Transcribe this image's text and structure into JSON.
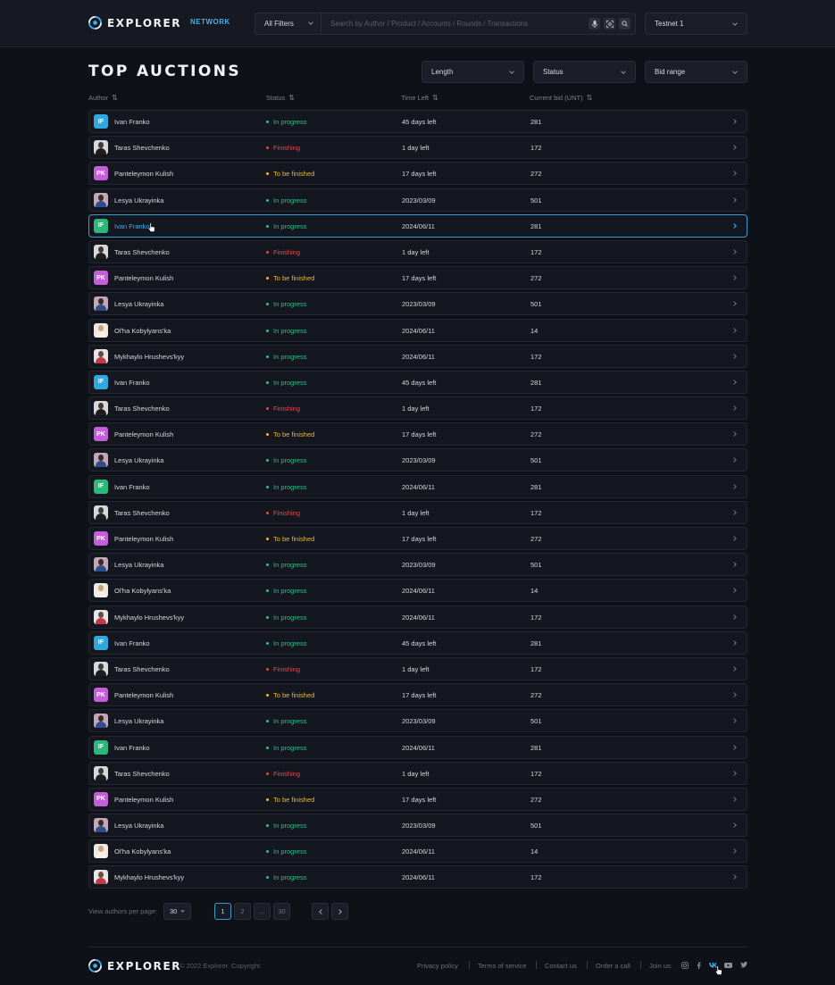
{
  "header": {
    "logo_text": "EXPLORER",
    "nav_network": "NETWORK",
    "filter_label": "All Filters",
    "search_placeholder": "Search by Author / Product / Accounts / Rounds / Transactions",
    "network_select": "Testnet 1"
  },
  "page": {
    "title": "TOP AUCTIONS",
    "filters": [
      "Length",
      "Status",
      "Bid range"
    ]
  },
  "table": {
    "columns": [
      "Author",
      "Status",
      "Time Left",
      "Current bid (UNT)"
    ],
    "rows": [
      {
        "avatar": "IF",
        "name": "Ivan Franko",
        "status": "In progress",
        "time": "45 days left",
        "bid": "281"
      },
      {
        "avatar": "TS",
        "name": "Taras Shevchenko",
        "status": "Finishing",
        "time": "1 day left",
        "bid": "172"
      },
      {
        "avatar": "PK",
        "name": "Panteleymon Kulish",
        "status": "To be finished",
        "time": "17 days left",
        "bid": "272"
      },
      {
        "avatar": "LU",
        "name": "Lesya Ukrayinka",
        "status": "In progress",
        "time": "2023/03/09",
        "bid": "501"
      },
      {
        "avatar": "IF",
        "name": "Ivan Franko",
        "status": "In progress",
        "time": "2024/06/11",
        "bid": "281"
      },
      {
        "avatar": "TS",
        "name": "Taras Shevchenko",
        "status": "Finishing",
        "time": "1 day left",
        "bid": "172"
      },
      {
        "avatar": "PK",
        "name": "Panteleymon Kulish",
        "status": "To be finished",
        "time": "17 days left",
        "bid": "272"
      },
      {
        "avatar": "LU",
        "name": "Lesya Ukrayinka",
        "status": "In progress",
        "time": "2023/03/09",
        "bid": "501"
      },
      {
        "avatar": "OK",
        "name": "Ol'ha Kobylyans'ka",
        "status": "In progress",
        "time": "2024/06/11",
        "bid": "14"
      },
      {
        "avatar": "MH",
        "name": "Mykhaylo Hrushevs'kyy",
        "status": "In progress",
        "time": "2024/06/11",
        "bid": "172"
      },
      {
        "avatar": "IF",
        "name": "Ivan Franko",
        "status": "In progress",
        "time": "45 days left",
        "bid": "281"
      },
      {
        "avatar": "TS",
        "name": "Taras Shevchenko",
        "status": "Finishing",
        "time": "1 day left",
        "bid": "172"
      },
      {
        "avatar": "PK",
        "name": "Panteleymon Kulish",
        "status": "To be finished",
        "time": "17 days left",
        "bid": "272"
      },
      {
        "avatar": "LU",
        "name": "Lesya Ukrayinka",
        "status": "In progress",
        "time": "2023/03/09",
        "bid": "501"
      },
      {
        "avatar": "IF",
        "name": "Ivan Franko",
        "status": "In progress",
        "time": "2024/06/11",
        "bid": "281"
      },
      {
        "avatar": "TS",
        "name": "Taras Shevchenko",
        "status": "Finishing",
        "time": "1 day left",
        "bid": "172"
      },
      {
        "avatar": "PK",
        "name": "Panteleymon Kulish",
        "status": "To be finished",
        "time": "17 days left",
        "bid": "272"
      },
      {
        "avatar": "LU",
        "name": "Lesya Ukrayinka",
        "status": "In progress",
        "time": "2023/03/09",
        "bid": "501"
      },
      {
        "avatar": "OK",
        "name": "Ol'ha Kobylyans'ka",
        "status": "In progress",
        "time": "2024/06/11",
        "bid": "14"
      },
      {
        "avatar": "MH",
        "name": "Mykhaylo Hrushevs'kyy",
        "status": "In progress",
        "time": "2024/06/11",
        "bid": "172"
      },
      {
        "avatar": "IF",
        "name": "Ivan Franko",
        "status": "In progress",
        "time": "45 days left",
        "bid": "281"
      },
      {
        "avatar": "TS",
        "name": "Taras Shevchenko",
        "status": "Finishing",
        "time": "1 day left",
        "bid": "172"
      },
      {
        "avatar": "PK",
        "name": "Panteleymon Kulish",
        "status": "To be finished",
        "time": "17 days left",
        "bid": "272"
      },
      {
        "avatar": "LU",
        "name": "Lesya Ukrayinka",
        "status": "In progress",
        "time": "2023/03/09",
        "bid": "501"
      },
      {
        "avatar": "IF",
        "name": "Ivan Franko",
        "status": "In progress",
        "time": "2024/06/11",
        "bid": "281"
      },
      {
        "avatar": "TS",
        "name": "Taras Shevchenko",
        "status": "Finishing",
        "time": "1 day left",
        "bid": "172"
      },
      {
        "avatar": "PK",
        "name": "Panteleymon Kulish",
        "status": "To be finished",
        "time": "17 days left",
        "bid": "272"
      },
      {
        "avatar": "LU",
        "name": "Lesya Ukrayinka",
        "status": "In progress",
        "time": "2023/03/09",
        "bid": "501"
      },
      {
        "avatar": "OK",
        "name": "Ol'ha Kobylyans'ka",
        "status": "In progress",
        "time": "2024/06/11",
        "bid": "14"
      },
      {
        "avatar": "MH",
        "name": "Mykhaylo Hrushevs'kyy",
        "status": "In progress",
        "time": "2024/06/11",
        "bid": "172"
      }
    ],
    "active_row": 4
  },
  "pagination": {
    "per_page_label": "View authors per page:",
    "per_page_value": "30",
    "pages": [
      "1",
      "2",
      "...",
      "30"
    ],
    "current_page": "1"
  },
  "footer": {
    "logo_text": "EXPLORER",
    "copyright": "© 2022 Explorer. Copyright",
    "links": [
      "Privacy policy",
      "Terms of service",
      "Contact us",
      "Order a call"
    ],
    "join_label": "Join us:",
    "socials": [
      "instagram-icon",
      "facebook-icon",
      "vk-icon",
      "youtube-icon",
      "twitter-icon"
    ]
  },
  "colors": {
    "accent": "#3db3e8",
    "in_progress": "#2fbf88",
    "finishing": "#e5484d",
    "to_be_finished": "#e9b92c",
    "background": "#0f1119"
  }
}
